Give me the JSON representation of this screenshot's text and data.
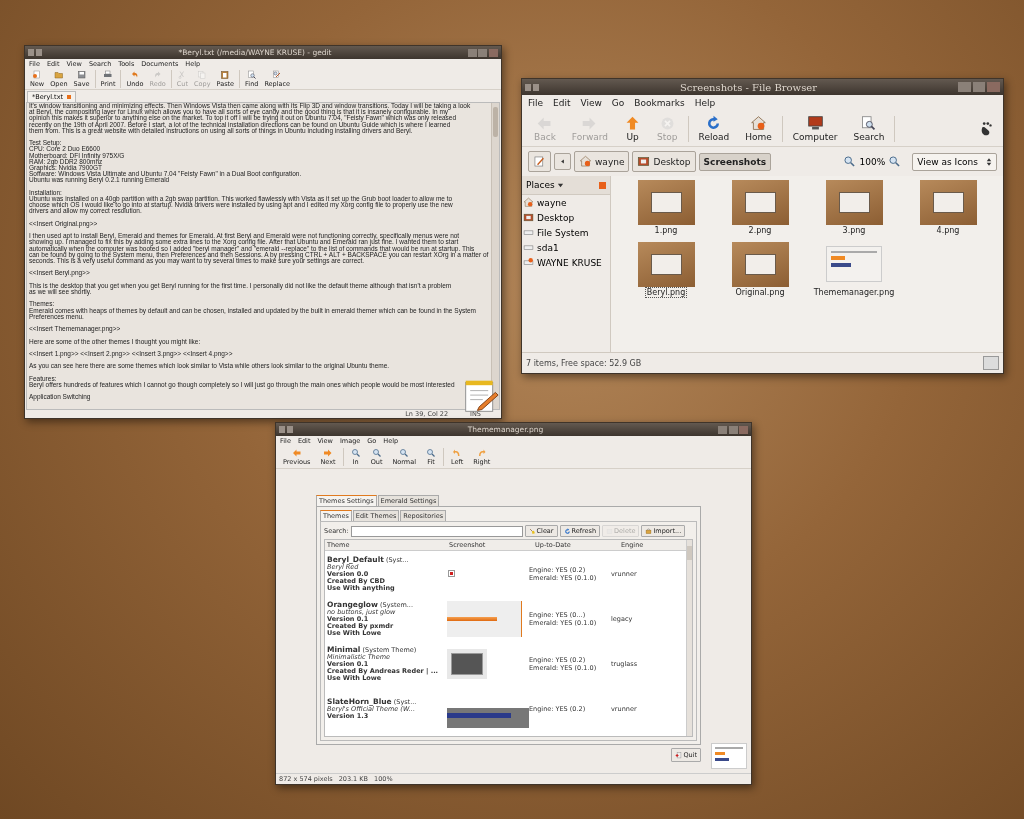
{
  "editor_window": {
    "title": "*Beryl.txt (/media/WAYNE KRUSE) - gedit",
    "menu": [
      "File",
      "Edit",
      "View",
      "Search",
      "Tools",
      "Documents",
      "Help"
    ],
    "toolbar": [
      {
        "label": "New",
        "kind": "new",
        "disabled": false
      },
      {
        "label": "Open",
        "kind": "open",
        "disabled": false
      },
      {
        "label": "Save",
        "kind": "save",
        "disabled": false
      },
      {
        "label": "Print",
        "kind": "print",
        "disabled": false
      },
      {
        "label": "Undo",
        "kind": "undo",
        "disabled": false
      },
      {
        "label": "Redo",
        "kind": "redo",
        "disabled": true
      },
      {
        "label": "Cut",
        "kind": "cut",
        "disabled": true
      },
      {
        "label": "Copy",
        "kind": "copy",
        "disabled": true
      },
      {
        "label": "Paste",
        "kind": "paste",
        "disabled": false
      },
      {
        "label": "Find",
        "kind": "find",
        "disabled": false
      },
      {
        "label": "Replace",
        "kind": "replace",
        "disabled": false
      }
    ],
    "tab": {
      "label": "*Beryl.txt"
    },
    "document": [
      {
        "lines": [
          "It's window transitioning and minimizing effects. Then Windows Vista then came along with its Flip 3D and window transitions. Today I will be taking a look",
          "at Beryl, the compositing layer for Linux which allows you to have all sorts of eye candy and the good thing is that it is insanely configurable. In my",
          "opinion this makes it superior to anything else on the market. To top it off I will be trying it out on Ubuntu 7.04, \"Feisty Fawn\" which was only released",
          "recently on the 19th of April 2007. Before I start, a lot of the technical installation directions can be found on Ubuntu Guide which is where I learned",
          "them from. This is a great website with detailed instructions on using all sorts of things in Ubuntu including installing drivers and Beryl."
        ]
      },
      {
        "lines": [
          "Test Setup:",
          "CPU: Core 2 Duo E6600",
          "Motherboard: DFI Infinity 975X/G",
          "RAM: 2gb DDR2 800mhz",
          "Graphics: Nvidia 7900GT",
          "Software: Windows Vista Ultimate and Ubuntu 7.04 \"Feisty Fawn\" in a Dual Boot configuration.",
          "Ubuntu was running Beryl 0.2.1 running Emerald"
        ]
      },
      {
        "lines": [
          "Installation:",
          "Ubuntu was installed on a 40gb partition with a 2gb swap partition. This worked flawlessly with Vista as it set up the Grub boot loader to allow me to",
          "choose which OS I would like to go into at startup. Nvidia drivers were installed by using apt and I edited my Xorg config file to properly use the new",
          "drivers and allow my correct resolution."
        ]
      },
      {
        "lines": [
          "<<Insert Original.png>>"
        ]
      },
      {
        "lines": [
          "I then used apt to install Beryl, Emerald and themes for Emerald. At first Beryl and Emerald were not functioning correctly, specifically menus were not",
          "showing up. I managed to fix this by adding some extra lines to the Xorg config file. After that Ubuntu and Emerald ran just fine. I wanted them to start",
          "automatically when the computer was booted so I added \"beryl manager\" and \"emerald --replace\" to the list of commands that would be run at startup. This",
          "can be found by going to the System menu, then Preferences and then Sessions. A by pressing CTRL + ALT + BACKSPACE you can restart XOrg in a matter of",
          "seconds. This is a very useful command as you may want to try several times to make sure your settings are correct."
        ]
      },
      {
        "lines": [
          "<<Insert Beryl.png>>"
        ]
      },
      {
        "lines": [
          "This is the desktop that you get when you get Beryl running for the first time. I personally did not like the default theme although that isn't a problem",
          "as we will see shortly."
        ]
      },
      {
        "lines": [
          "Themes:",
          "Emerald comes with heaps of themes by default and can be chosen, installed and updated by the built in emerald themer which can be found in the System",
          "Preferences menu."
        ]
      },
      {
        "lines": [
          "<<Insert Thememanager.png>>"
        ]
      },
      {
        "lines": [
          "Here are some of the other themes I thought you might like:"
        ]
      },
      {
        "lines": [
          "<<Insert 1.png>> <<Insert 2.png>> <<Insert 3.png>> <<Insert 4.png>>"
        ]
      },
      {
        "lines": [
          "As you can see here there are some themes which look similar to Vista while others look similar to the original Ubuntu theme."
        ]
      },
      {
        "lines": [
          "Features:",
          "Beryl offers hundreds of features which I cannot go though completely so I will just go through the main ones which people would be most interested"
        ]
      },
      {
        "lines": [
          "Application Switching"
        ]
      }
    ],
    "status": {
      "position": "Ln 39, Col 22",
      "mode": "INS"
    }
  },
  "file_browser": {
    "title": "Screenshots - File Browser",
    "menu": [
      "File",
      "Edit",
      "View",
      "Go",
      "Bookmarks",
      "Help"
    ],
    "toolbar": [
      {
        "label": "Back",
        "kind": "back",
        "disabled": true
      },
      {
        "label": "Forward",
        "kind": "forward",
        "disabled": true
      },
      {
        "label": "Up",
        "kind": "up",
        "disabled": false
      },
      {
        "label": "Stop",
        "kind": "stop",
        "disabled": true
      },
      {
        "label": "Reload",
        "kind": "reload",
        "disabled": false
      },
      {
        "label": "Home",
        "kind": "home",
        "disabled": false
      },
      {
        "label": "Computer",
        "kind": "computer",
        "disabled": false
      },
      {
        "label": "Search",
        "kind": "search",
        "disabled": false
      }
    ],
    "path": [
      {
        "label": "wayne",
        "kind": "home",
        "selected": false
      },
      {
        "label": "Desktop",
        "kind": "desktop",
        "selected": false
      },
      {
        "label": "Screenshots",
        "kind": "none",
        "selected": true
      }
    ],
    "zoom": "100%",
    "view_mode": "View as Icons",
    "sidebar": {
      "title": "Places",
      "items": [
        {
          "label": "wayne",
          "kind": "home"
        },
        {
          "label": "Desktop",
          "kind": "desktop"
        },
        {
          "label": "File System",
          "kind": "drive"
        },
        {
          "label": "sda1",
          "kind": "drive"
        },
        {
          "label": "WAYNE KRUSE",
          "kind": "usb"
        }
      ]
    },
    "files": [
      {
        "name": "1.png",
        "kind": "desktop",
        "selected": false
      },
      {
        "name": "2.png",
        "kind": "desktop",
        "selected": false
      },
      {
        "name": "3.png",
        "kind": "desktop",
        "selected": false
      },
      {
        "name": "4.png",
        "kind": "desktop",
        "selected": false
      },
      {
        "name": "Beryl.png",
        "kind": "desktop",
        "selected": true
      },
      {
        "name": "Original.png",
        "kind": "desktop",
        "selected": false
      },
      {
        "name": "Thememanager.png",
        "kind": "window",
        "selected": false
      }
    ],
    "status": "7 items, Free space: 52.9 GB"
  },
  "image_viewer": {
    "title": "Thememanager.png",
    "menu": [
      "File",
      "Edit",
      "View",
      "Image",
      "Go",
      "Help"
    ],
    "toolbar": [
      {
        "label": "Previous",
        "kind": "previous",
        "disabled": false
      },
      {
        "label": "Next",
        "kind": "next",
        "disabled": false
      },
      {
        "label": "In",
        "kind": "zoomin",
        "disabled": false
      },
      {
        "label": "Out",
        "kind": "zoomout",
        "disabled": false
      },
      {
        "label": "Normal",
        "kind": "zoomnormal",
        "disabled": false
      },
      {
        "label": "Fit",
        "kind": "zoomfit",
        "disabled": false
      },
      {
        "label": "Left",
        "kind": "rotleft",
        "disabled": false
      },
      {
        "label": "Right",
        "kind": "rotright",
        "disabled": false
      }
    ],
    "image": {
      "tabs": [
        {
          "label": "Themes Settings",
          "selected": true
        },
        {
          "label": "Emerald Settings",
          "selected": false
        }
      ],
      "subtabs": [
        {
          "label": "Themes",
          "selected": true
        },
        {
          "label": "Edit Themes",
          "selected": false
        },
        {
          "label": "Repositories",
          "selected": false
        }
      ],
      "search_label": "Search:",
      "buttons": [
        {
          "label": "Clear",
          "kind": "clear",
          "disabled": false
        },
        {
          "label": "Refresh",
          "kind": "refresh",
          "disabled": false
        },
        {
          "label": "Delete",
          "kind": "delete",
          "disabled": true
        },
        {
          "label": "Import...",
          "kind": "import",
          "disabled": false
        }
      ],
      "columns": [
        "Theme",
        "Screenshot",
        "Up-to-Date",
        "Engine"
      ],
      "rows": [
        {
          "name": "Beryl_Default",
          "tag": "(Syst...",
          "description": "Beryl Red",
          "details": [
            "Version 0.0",
            "Created By CBD",
            "Use With anything"
          ],
          "kind": "mark",
          "uptodate": [
            "Engine: YES (0.2)",
            "Emerald: YES (0.1.0)"
          ],
          "engine": "vrunner"
        },
        {
          "name": "Orangeglow",
          "tag": "(System...",
          "description": "no buttons, just glow",
          "details": [
            "Version 0.1",
            "Created By pxmdr",
            "Use With Lowe"
          ],
          "kind": "orange",
          "uptodate": [
            "Engine: YES (0...)",
            "Emerald: YES (0.1.0)"
          ],
          "engine": "legacy"
        },
        {
          "name": "Minimal",
          "tag": "(System Theme)",
          "description": "Minimalistic Theme",
          "details": [
            "Version 0.1",
            "Created By Andreas Reder | ...",
            "Use With Lowe"
          ],
          "kind": "dark",
          "uptodate": [
            "Engine: YES (0.2)",
            "Emerald: YES (0.1.0)"
          ],
          "engine": "truglass"
        },
        {
          "name": "SlateHorn_Blue",
          "tag": "(Syst...",
          "description": "Beryl's Official Theme (W...",
          "details": [
            "Version 1.3"
          ],
          "kind": "blue",
          "uptodate": [
            "Engine: YES (0.2)"
          ],
          "engine": "vrunner"
        }
      ],
      "quit": "Quit"
    },
    "status": [
      "872 x 574 pixels",
      "203.1 KB",
      "100%"
    ]
  }
}
